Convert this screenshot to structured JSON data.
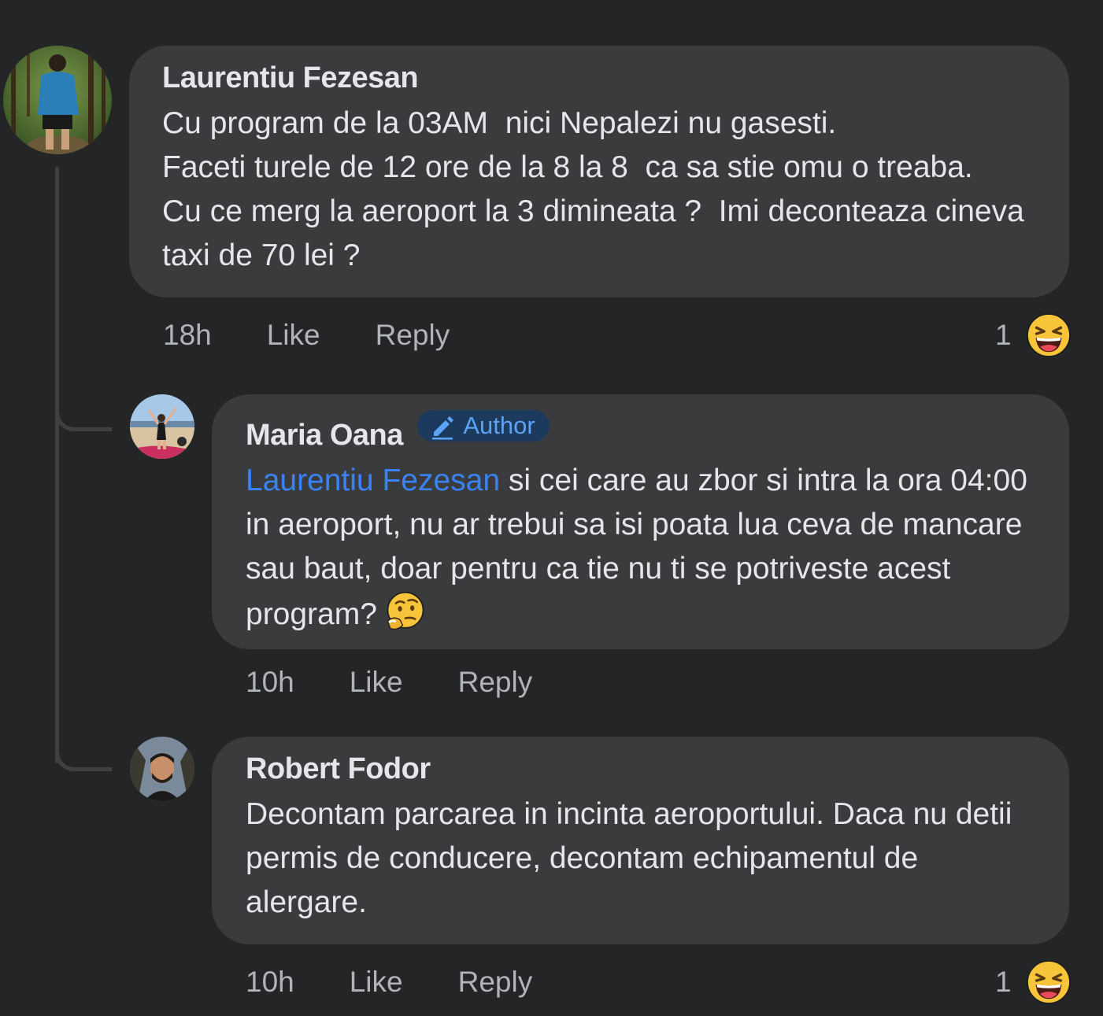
{
  "comments": [
    {
      "author": "Laurentiu Fezesan",
      "text": "Cu program de la 03AM  nici Nepalezi nu gasesti.\nFaceti turele de 12 ore de la 8 la 8  ca sa stie omu o treaba.    Cu ce merg la aeroport la 3 dimineata ?  Imi deconteaza cineva taxi de 70 lei ?",
      "time": "18h",
      "like_label": "Like",
      "reply_label": "Reply",
      "reaction_count": "1",
      "reaction_icon": "laughing-emoji-icon"
    },
    {
      "author": "Maria Oana",
      "badge": "Author",
      "mention": "Laurentiu Fezesan",
      "text": " si cei care au zbor si intra la ora 04:00 in aeroport, nu ar trebui sa isi poata lua ceva de mancare sau baut, doar pentru ca tie nu ti se potriveste acest program?",
      "inline_emoji": "thinking-emoji-icon",
      "time": "10h",
      "like_label": "Like",
      "reply_label": "Reply"
    },
    {
      "author": "Robert Fodor",
      "text": "Decontam parcarea in incinta aeroportului. Daca nu detii permis de conducere, decontam echipamentul de alergare.",
      "time": "10h",
      "like_label": "Like",
      "reply_label": "Reply",
      "reaction_count": "1",
      "reaction_icon": "laughing-emoji-icon"
    }
  ],
  "colors": {
    "background": "#242526",
    "bubble": "#3a3b3c",
    "text": "#e4e6eb",
    "secondary_text": "#b0b3b8",
    "mention": "#3b82f6",
    "badge_bg": "#1c3a5e",
    "badge_text": "#5aa3f5"
  }
}
